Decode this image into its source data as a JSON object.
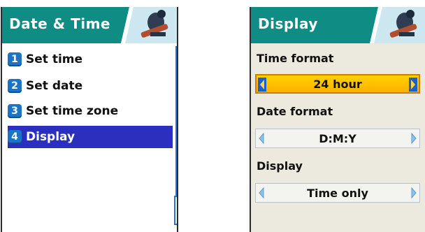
{
  "left_screen": {
    "title": "Date & Time",
    "menu": [
      {
        "num": "1",
        "label": "Set time"
      },
      {
        "num": "2",
        "label": "Set date"
      },
      {
        "num": "3",
        "label": "Set time zone"
      },
      {
        "num": "4",
        "label": "Display",
        "selected": true
      }
    ]
  },
  "right_screen": {
    "title": "Display",
    "settings": [
      {
        "label": "Time format",
        "value": "24 hour",
        "active": true
      },
      {
        "label": "Date format",
        "value": "D:M:Y",
        "active": false
      },
      {
        "label": "Display",
        "value": "Time only",
        "active": false
      }
    ]
  },
  "colors": {
    "header": "#0f8c83",
    "selection": "#2a2fbd",
    "number_badge": "#1c74c7",
    "active_selector": "#ffc000",
    "scrollbar": "#2a72d6"
  }
}
